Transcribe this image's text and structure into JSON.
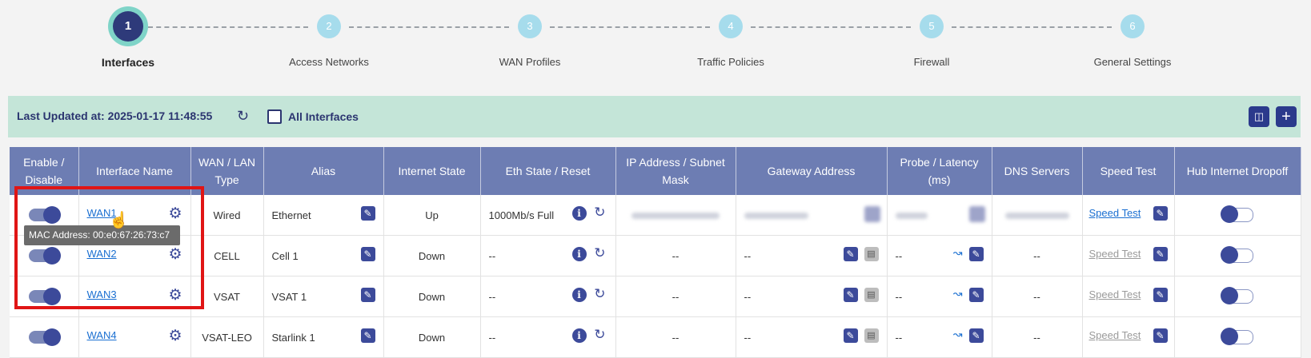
{
  "stepper": {
    "steps": [
      {
        "num": "1",
        "label": "Interfaces"
      },
      {
        "num": "2",
        "label": "Access Networks"
      },
      {
        "num": "3",
        "label": "WAN Profiles"
      },
      {
        "num": "4",
        "label": "Traffic Policies"
      },
      {
        "num": "5",
        "label": "Firewall"
      },
      {
        "num": "6",
        "label": "General Settings"
      }
    ],
    "active": "1"
  },
  "toolbar": {
    "last_updated": "Last Updated at: 2025-01-17 11:48:55",
    "all_interfaces": "All Interfaces",
    "icons": [
      "refresh-icon",
      "folder-icon",
      "plus-icon"
    ]
  },
  "table": {
    "headers": [
      "Enable / Disable",
      "Interface Name",
      "WAN / LAN Type",
      "Alias",
      "Internet State",
      "Eth State / Reset",
      "IP Address / Subnet Mask",
      "Gateway Address",
      "Probe / Latency (ms)",
      "DNS Servers",
      "Speed Test",
      "Hub Internet Dropoff"
    ],
    "rows": [
      {
        "enabled": true,
        "name": "WAN1",
        "type": "Wired",
        "alias": "Ethernet",
        "internet_state": "Up",
        "eth_state": "1000Mb/s Full",
        "ip": "",
        "gateway": "",
        "probe": "",
        "dns": "",
        "speed_test": "Speed Test",
        "hub_dropoff": false
      },
      {
        "enabled": true,
        "name": "WAN2",
        "type": "CELL",
        "alias": "Cell 1",
        "internet_state": "Down",
        "eth_state": "--",
        "ip": "--",
        "gateway": "--",
        "probe": "--",
        "dns": "--",
        "speed_test": "Speed Test",
        "hub_dropoff": false
      },
      {
        "enabled": true,
        "name": "WAN3",
        "type": "VSAT",
        "alias": "VSAT 1",
        "internet_state": "Down",
        "eth_state": "--",
        "ip": "--",
        "gateway": "--",
        "probe": "--",
        "dns": "--",
        "speed_test": "Speed Test",
        "hub_dropoff": false
      },
      {
        "enabled": true,
        "name": "WAN4",
        "type": "VSAT-LEO",
        "alias": "Starlink 1",
        "internet_state": "Down",
        "eth_state": "--",
        "ip": "--",
        "gateway": "--",
        "probe": "--",
        "dns": "--",
        "speed_test": "Speed Test",
        "hub_dropoff": false
      }
    ]
  },
  "tooltip": "MAC Address: 00:e0:67:26:73:c7",
  "colors": {
    "header_bg": "#6d7db3",
    "toolbar_bg": "#c4e5d8",
    "accent": "#2e3a7a",
    "highlight": "#e01515"
  }
}
